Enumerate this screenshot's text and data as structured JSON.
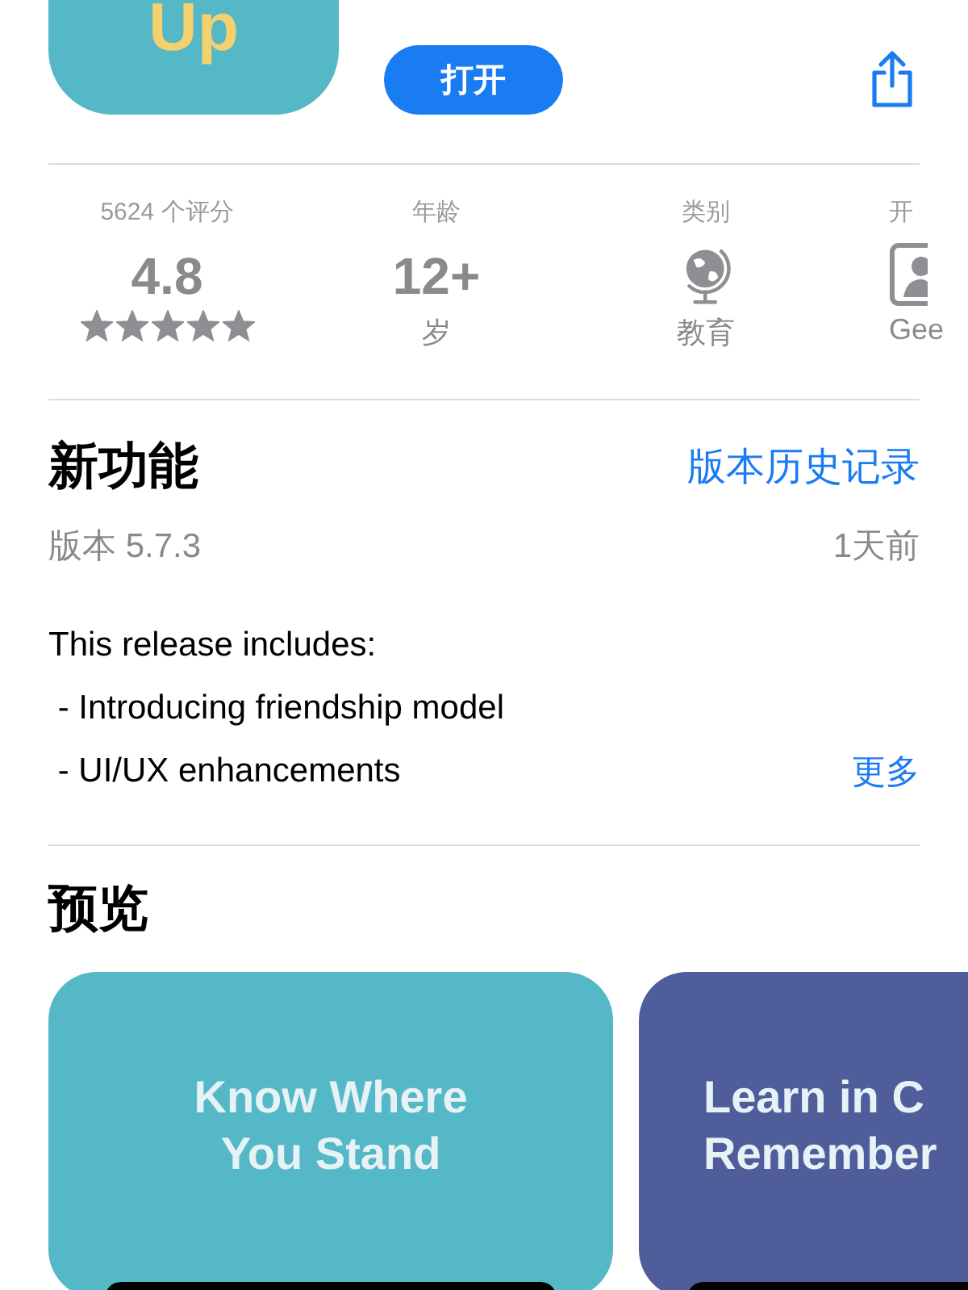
{
  "app": {
    "icon_text": "Up",
    "open_button": "打开"
  },
  "stats": [
    {
      "kind": "rating",
      "label": "5624 个评分",
      "value": "4.8",
      "stars": 5
    },
    {
      "kind": "age",
      "label": "年龄",
      "value": "12+",
      "sub": "岁"
    },
    {
      "kind": "category",
      "label": "类别",
      "sub": "教育"
    },
    {
      "kind": "developer",
      "label": "开",
      "sub": "Gee"
    }
  ],
  "whats_new": {
    "title": "新功能",
    "link": "版本历史记录",
    "version": "版本 5.7.3",
    "date": "1天前",
    "notes": [
      "This release includes:",
      " - Introducing friendship model",
      " - UI/UX enhancements"
    ],
    "more": "更多"
  },
  "preview": {
    "title": "预览",
    "screenshots": [
      {
        "lines": [
          "Know Where",
          "You Stand"
        ],
        "color": "#55b8c6"
      },
      {
        "lines": [
          "Learn in C",
          "Remember"
        ],
        "color": "#4f5d9b"
      }
    ]
  }
}
